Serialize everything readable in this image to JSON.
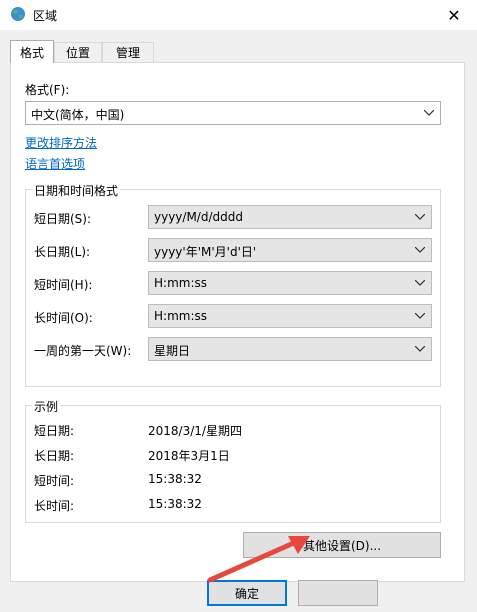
{
  "window": {
    "title": "区域",
    "close_glyph": "✕"
  },
  "tabs": [
    {
      "label": "格式",
      "active": true
    },
    {
      "label": "位置",
      "active": false
    },
    {
      "label": "管理",
      "active": false
    }
  ],
  "format": {
    "label": "格式(F):",
    "value": "中文(简体，中国)"
  },
  "links": {
    "sort": "更改排序方法",
    "language": "语言首选项"
  },
  "datetime": {
    "title": "日期和时间格式",
    "rows": [
      {
        "label": "短日期(S):",
        "value": "yyyy/M/d/dddd"
      },
      {
        "label": "长日期(L):",
        "value": "yyyy'年'M'月'd'日'"
      },
      {
        "label": "短时间(H):",
        "value": "H:mm:ss"
      },
      {
        "label": "长时间(O):",
        "value": "H:mm:ss"
      },
      {
        "label": "一周的第一天(W):",
        "value": "星期日"
      }
    ]
  },
  "examples": {
    "title": "示例",
    "rows": [
      {
        "label": "短日期:",
        "value": "2018/3/1/星期四"
      },
      {
        "label": "长日期:",
        "value": "2018年3月1日"
      },
      {
        "label": "短时间:",
        "value": "15:38:32"
      },
      {
        "label": "长时间:",
        "value": "15:38:32"
      }
    ]
  },
  "buttons": {
    "other_settings": "其他设置(D)...",
    "ok": "确定"
  },
  "colors": {
    "accent": "#0078d7",
    "link": "#0066cc",
    "arrow": "#e8473d"
  }
}
